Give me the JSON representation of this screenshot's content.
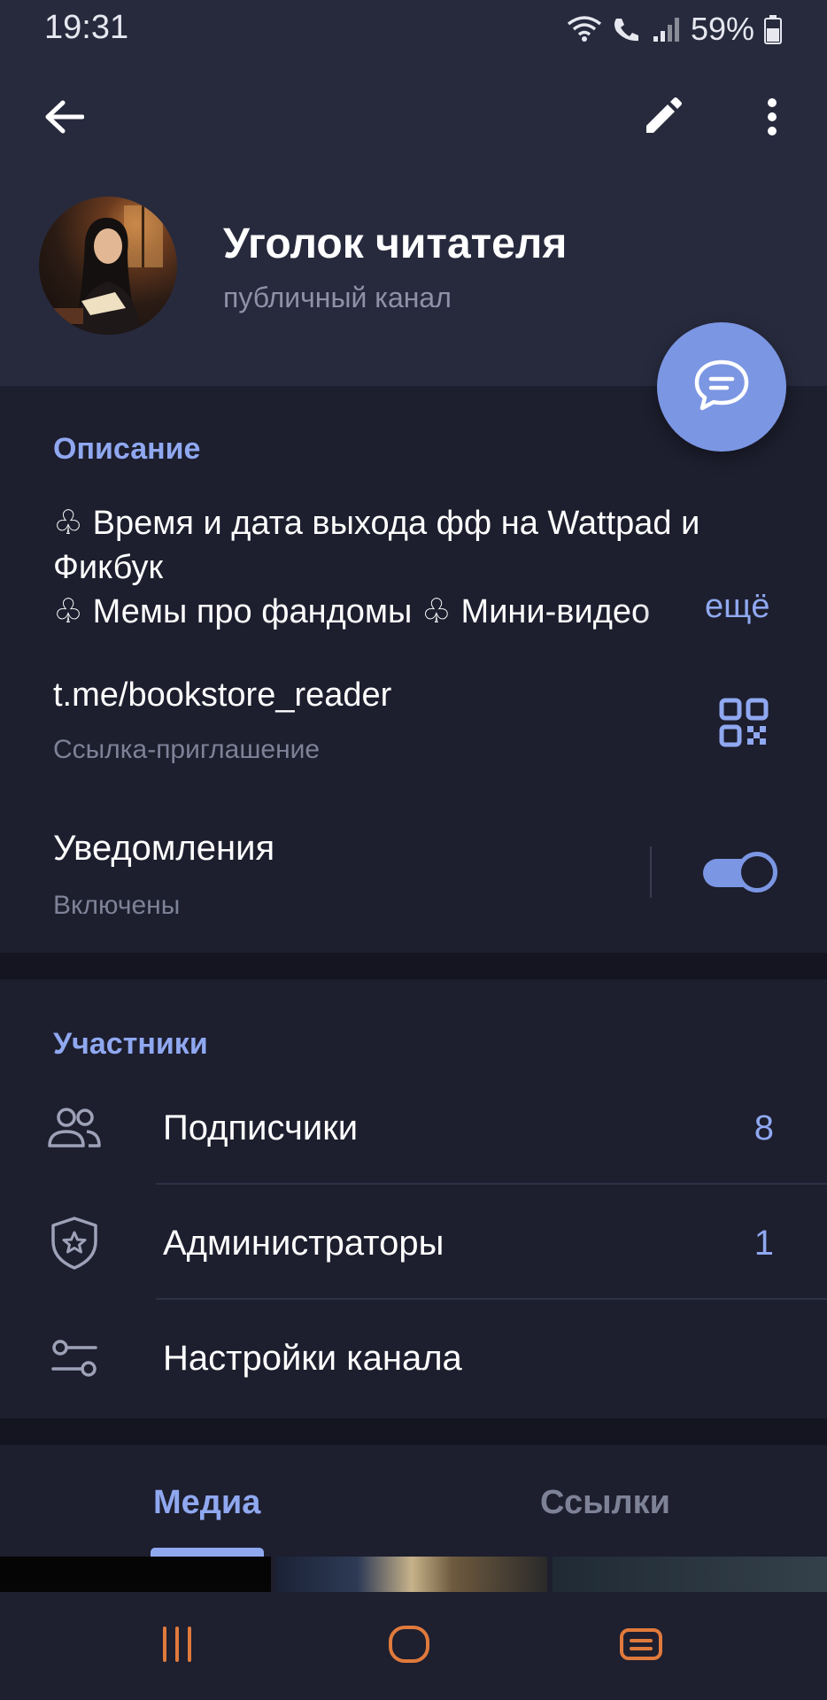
{
  "status_bar": {
    "time": "19:31",
    "battery": "59%"
  },
  "toolbar": {
    "back_icon": "arrow-left-icon",
    "edit_icon": "pencil-icon",
    "more_icon": "more-vertical-icon"
  },
  "channel": {
    "title": "Уголок читателя",
    "subtitle": "публичный канал"
  },
  "info": {
    "description_label": "Описание",
    "description_text": "♧ Время и дата выхода фф на Wattpad и Фикбук\n♧ Мемы про фандомы  ♧ Мини-видео",
    "more_label": "ещё",
    "link": "t.me/bookstore_reader",
    "link_caption": "Ссылка-приглашение",
    "notifications_title": "Уведомления",
    "notifications_state": "Включены",
    "notifications_enabled": true
  },
  "members": {
    "label": "Участники",
    "items": [
      {
        "label": "Подписчики",
        "count": "8",
        "icon": "users-icon"
      },
      {
        "label": "Администраторы",
        "count": "1",
        "icon": "shield-star-icon"
      },
      {
        "label": "Настройки канала",
        "count": "",
        "icon": "sliders-icon"
      }
    ]
  },
  "tabs": [
    {
      "label": "Медиа",
      "active": true
    },
    {
      "label": "Ссылки",
      "active": false
    }
  ],
  "colors": {
    "accent": "#8fa8f0",
    "fab": "#7b96e3",
    "background": "#1d1e2e",
    "header": "#272a3d"
  }
}
